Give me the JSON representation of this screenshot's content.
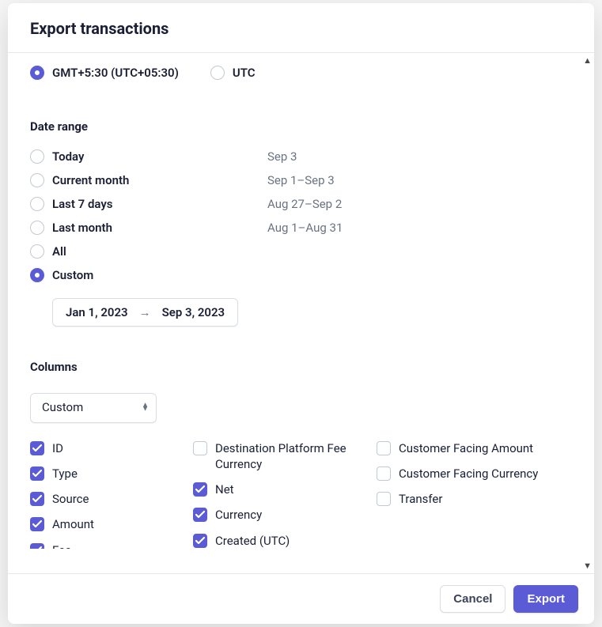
{
  "header": {
    "title": "Export transactions"
  },
  "timezone": {
    "options": [
      {
        "label": "GMT+5:30 (UTC+05:30)",
        "selected": true
      },
      {
        "label": "UTC",
        "selected": false
      }
    ]
  },
  "dateRange": {
    "title": "Date range",
    "items": [
      {
        "label": "Today",
        "value": "Sep 3",
        "selected": false
      },
      {
        "label": "Current month",
        "value": "Sep 1–Sep 3",
        "selected": false
      },
      {
        "label": "Last 7 days",
        "value": "Aug 27–Sep 2",
        "selected": false
      },
      {
        "label": "Last month",
        "value": "Aug 1–Aug 31",
        "selected": false
      },
      {
        "label": "All",
        "value": "",
        "selected": false
      },
      {
        "label": "Custom",
        "value": "",
        "selected": true
      }
    ],
    "customStart": "Jan 1, 2023",
    "customEnd": "Sep 3, 2023"
  },
  "columns": {
    "title": "Columns",
    "preset": "Custom",
    "groups": [
      [
        {
          "label": "ID",
          "checked": true
        },
        {
          "label": "Type",
          "checked": true
        },
        {
          "label": "Source",
          "checked": true
        },
        {
          "label": "Amount",
          "checked": true
        },
        {
          "label": "Fee",
          "checked": true
        }
      ],
      [
        {
          "label": "Destination Platform Fee Currency",
          "checked": false
        },
        {
          "label": "Net",
          "checked": true
        },
        {
          "label": "Currency",
          "checked": true
        },
        {
          "label": "Created (UTC)",
          "checked": true
        }
      ],
      [
        {
          "label": "Customer Facing Amount",
          "checked": false
        },
        {
          "label": "Customer Facing Currency",
          "checked": false
        },
        {
          "label": "Transfer",
          "checked": false
        }
      ]
    ]
  },
  "footer": {
    "cancel": "Cancel",
    "export": "Export"
  },
  "colors": {
    "accent": "#5b5bd6"
  }
}
